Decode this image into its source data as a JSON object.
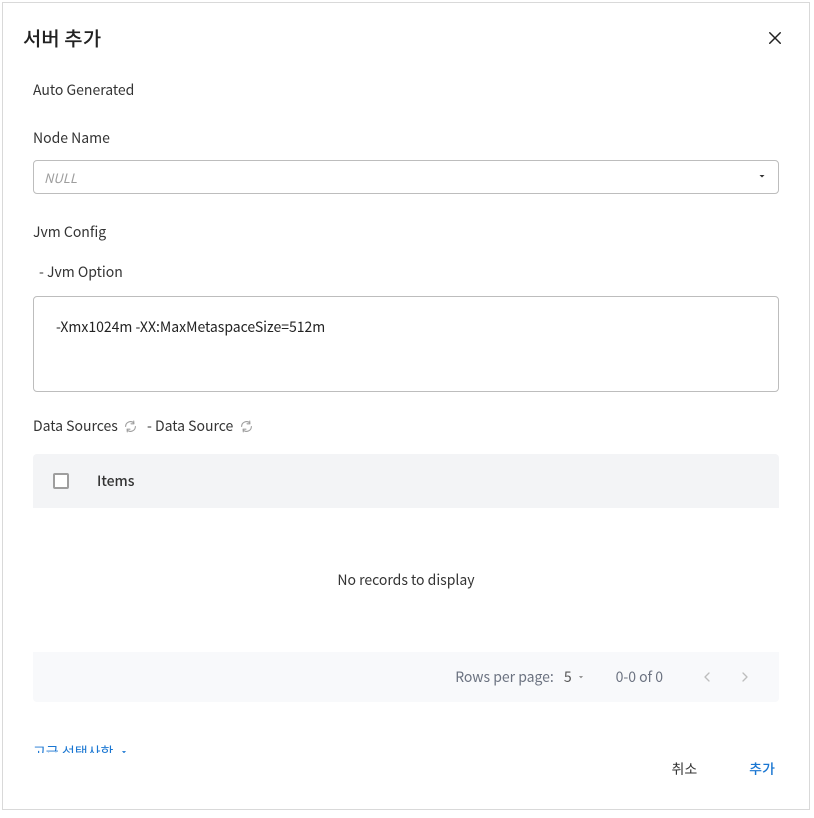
{
  "dialog": {
    "title": "서버 추가"
  },
  "sections": {
    "auto_generated": "Auto Generated",
    "node_name_label": "Node Name",
    "node_name_placeholder": "NULL",
    "jvm_config_label": "Jvm Config",
    "jvm_option_label": "- Jvm Option",
    "jvm_option_value": "-Xmx1024m -XX:MaxMetaspaceSize=512m",
    "data_sources_label": "Data Sources",
    "data_source_label": "- Data Source"
  },
  "table": {
    "col_items": "Items",
    "empty_text": "No records to display",
    "rows_per_page_label": "Rows per page:",
    "rows_per_page_value": "5",
    "range_text": "0-0 of 0"
  },
  "advanced_label": "고급 선택사항",
  "footer": {
    "cancel": "취소",
    "submit": "추가"
  }
}
